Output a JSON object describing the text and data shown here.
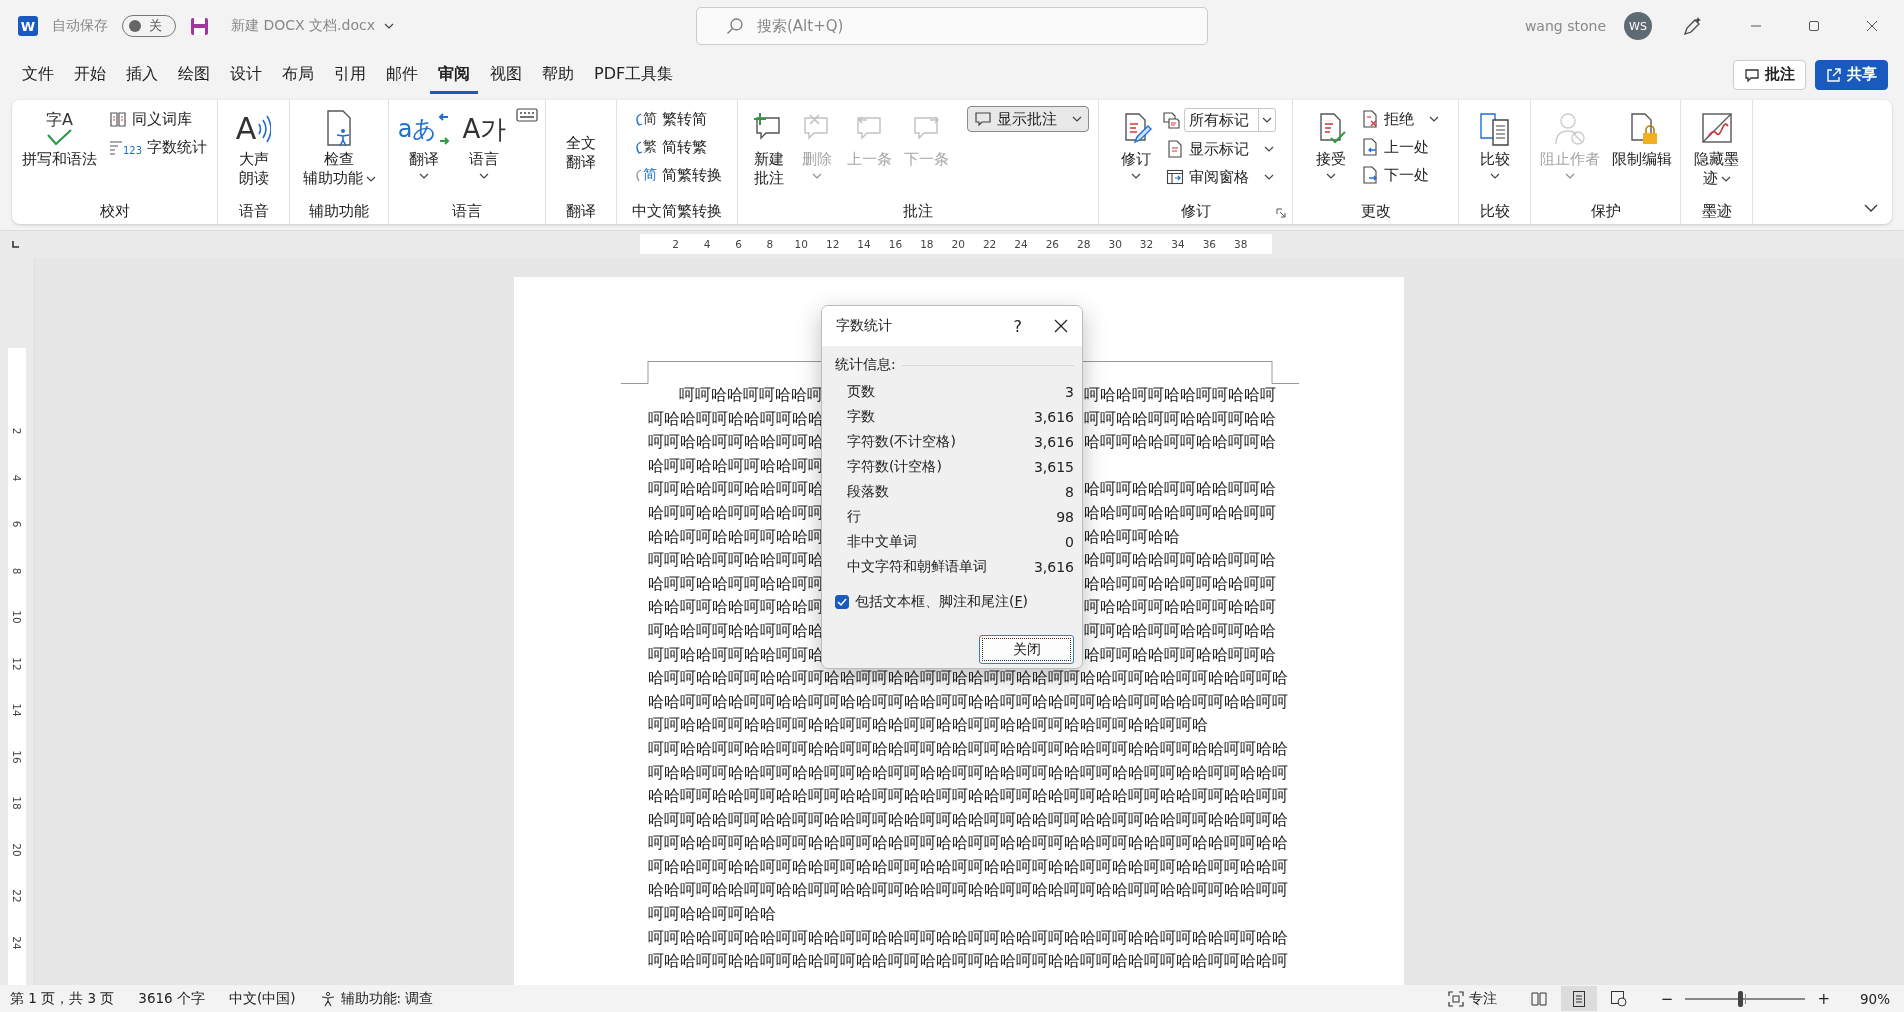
{
  "title_bar": {
    "logo_text": "W",
    "autosave_label": "自动保存",
    "autosave": {
      "on": false,
      "text": "关"
    },
    "file_name": "新建 DOCX 文档.docx",
    "search": {
      "placeholder": "搜索(Alt+Q)"
    },
    "user_name": "wang stone",
    "avatar_initials": "WS"
  },
  "tabs": [
    {
      "label": "文件",
      "selected": false
    },
    {
      "label": "开始",
      "selected": false
    },
    {
      "label": "插入",
      "selected": false
    },
    {
      "label": "绘图",
      "selected": false
    },
    {
      "label": "设计",
      "selected": false
    },
    {
      "label": "布局",
      "selected": false
    },
    {
      "label": "引用",
      "selected": false
    },
    {
      "label": "邮件",
      "selected": false
    },
    {
      "label": "审阅",
      "selected": true
    },
    {
      "label": "视图",
      "selected": false
    },
    {
      "label": "帮助",
      "selected": false
    },
    {
      "label": "PDF工具集",
      "selected": false
    }
  ],
  "tab_buttons": [
    {
      "label": "批注",
      "kind": "plain"
    },
    {
      "label": "共享",
      "kind": "primary"
    }
  ],
  "ribbon": {
    "groups": [
      {
        "label": "校对",
        "launcher": false,
        "columns": [
          [
            {
              "kind": "large",
              "label": [
                "拼写和语法"
              ],
              "icon_text": "字A",
              "menu": false,
              "disabled": false
            }
          ],
          [
            {
              "kind": "small",
              "label": "同义词库",
              "menu": false,
              "disabled": false
            },
            {
              "kind": "small",
              "label": "字数统计",
              "icon_text": "123",
              "menu": false,
              "disabled": false
            }
          ]
        ]
      },
      {
        "label": "语音",
        "launcher": false,
        "columns": [
          [
            {
              "kind": "large",
              "label": [
                "大声",
                "朗读"
              ],
              "icon_text": "A",
              "menu": false,
              "disabled": false
            }
          ]
        ]
      },
      {
        "label": "辅助功能",
        "launcher": false,
        "columns": [
          [
            {
              "kind": "large",
              "label": [
                "检查",
                "辅助功能"
              ],
              "menu": true,
              "disabled": false
            }
          ]
        ]
      },
      {
        "label": "语言",
        "launcher": false,
        "columns": [
          [
            {
              "kind": "large",
              "label": [
                "翻译"
              ],
              "icon_text": "aあ",
              "menu": true,
              "disabled": false
            }
          ],
          [
            {
              "kind": "large",
              "label": [
                "语言"
              ],
              "icon_text": "A가",
              "menu": true,
              "disabled": false
            }
          ],
          [
            {
              "kind": "icon",
              "menu": false,
              "disabled": false
            }
          ]
        ]
      },
      {
        "label": "翻译",
        "launcher": false,
        "columns": [
          [
            {
              "kind": "text",
              "label": [
                "全文",
                "翻译"
              ],
              "menu": false,
              "disabled": false
            }
          ]
        ]
      },
      {
        "label": "中文简繁转换",
        "launcher": false,
        "columns": [
          [
            {
              "kind": "small",
              "label": "繁转简",
              "icon_text": "简",
              "menu": false,
              "disabled": false
            },
            {
              "kind": "small",
              "label": "简转繁",
              "icon_text": "繁",
              "menu": false,
              "disabled": false
            },
            {
              "kind": "small",
              "label": "简繁转换",
              "icon_text": "简",
              "menu": false,
              "disabled": false
            }
          ]
        ]
      },
      {
        "label": "批注",
        "launcher": false,
        "columns": [
          [
            {
              "kind": "large",
              "label": [
                "新建",
                "批注"
              ],
              "menu": false,
              "disabled": false
            }
          ],
          [
            {
              "kind": "large",
              "label": [
                "删除"
              ],
              "menu": true,
              "disabled": true
            }
          ],
          [
            {
              "kind": "large",
              "label": [
                "上一条"
              ],
              "menu": false,
              "disabled": true
            }
          ],
          [
            {
              "kind": "large",
              "label": [
                "下一条"
              ],
              "menu": false,
              "disabled": true
            }
          ],
          [
            {
              "kind": "toggle",
              "label": "显示批注",
              "on": true,
              "menu": true,
              "disabled": false
            }
          ]
        ]
      },
      {
        "label": "修订",
        "launcher": true,
        "columns": [
          [
            {
              "kind": "large",
              "label": [
                "修订"
              ],
              "menu": true,
              "disabled": false
            }
          ],
          [
            {
              "kind": "combo",
              "value": "所有标记",
              "menu": true,
              "disabled": false
            },
            {
              "kind": "small",
              "label": "显示标记",
              "menu": true,
              "disabled": false
            },
            {
              "kind": "small",
              "label": "审阅窗格",
              "menu": true,
              "disabled": false
            }
          ]
        ]
      },
      {
        "label": "更改",
        "launcher": false,
        "columns": [
          [
            {
              "kind": "large",
              "label": [
                "接受"
              ],
              "menu": true,
              "disabled": false
            }
          ],
          [
            {
              "kind": "small",
              "label": "拒绝",
              "menu": true,
              "disabled": false
            },
            {
              "kind": "small",
              "label": "上一处",
              "menu": false,
              "disabled": false
            },
            {
              "kind": "small",
              "label": "下一处",
              "menu": false,
              "disabled": false
            }
          ]
        ]
      },
      {
        "label": "比较",
        "launcher": false,
        "columns": [
          [
            {
              "kind": "large",
              "label": [
                "比较"
              ],
              "menu": true,
              "disabled": false
            }
          ]
        ]
      },
      {
        "label": "保护",
        "launcher": false,
        "columns": [
          [
            {
              "kind": "large",
              "label": [
                "阻止作者"
              ],
              "menu": true,
              "disabled": true
            }
          ],
          [
            {
              "kind": "large",
              "label": [
                "限制编辑"
              ],
              "menu": false,
              "disabled": false
            }
          ]
        ]
      },
      {
        "label": "墨迹",
        "launcher": false,
        "columns": [
          [
            {
              "kind": "large",
              "label": [
                "隐藏墨",
                "迹"
              ],
              "menu": true,
              "disabled": false
            }
          ]
        ]
      }
    ]
  },
  "ruler": {
    "numbers": [
      "2",
      "4",
      "6",
      "8",
      "10",
      "12",
      "14",
      "16",
      "18",
      "20",
      "22",
      "24",
      "26",
      "28",
      "30",
      "32",
      "34",
      "36",
      "38"
    ],
    "vertical_numbers": [
      "2",
      "4",
      "6",
      "8",
      "10",
      "12",
      "14",
      "16",
      "18",
      "20",
      "22",
      "24"
    ]
  },
  "document": {
    "lines": [
      {
        "kind": "split",
        "indent": true,
        "left": "呵呵哈哈呵呵哈哈呵",
        "right": "呵哈哈呵呵哈哈呵呵哈哈呵"
      },
      {
        "kind": "split",
        "indent": false,
        "left": "呵哈哈呵呵哈哈呵呵哈哈",
        "right": "呵呵哈哈呵呵哈哈呵呵哈哈"
      },
      {
        "kind": "split",
        "indent": false,
        "left": "呵呵哈哈呵呵哈哈呵呵哈",
        "right": "哈呵呵哈哈呵呵哈哈呵呵哈"
      },
      {
        "kind": "split",
        "indent": false,
        "left": "哈呵呵哈哈呵呵哈哈呵呵"
      },
      {
        "kind": "split",
        "indent": false,
        "left": "呵呵哈哈呵呵哈哈呵呵哈",
        "right": "哈呵呵哈哈呵呵哈哈呵呵哈"
      },
      {
        "kind": "split",
        "indent": false,
        "left": "哈呵呵哈哈呵呵哈哈呵呵",
        "right": "哈哈呵呵哈哈呵呵哈哈呵呵"
      },
      {
        "kind": "split",
        "indent": false,
        "left": "哈哈呵呵哈哈呵呵哈哈呵",
        "right": "哈哈呵呵哈哈"
      },
      {
        "kind": "split",
        "indent": false,
        "left": "呵呵哈哈呵呵哈哈呵呵哈",
        "right": "哈呵呵哈哈呵呵哈哈呵呵哈"
      },
      {
        "kind": "split",
        "indent": false,
        "left": "哈呵呵哈哈呵呵哈哈呵呵",
        "right": "哈哈呵呵哈哈呵呵哈哈呵呵"
      },
      {
        "kind": "split",
        "indent": false,
        "left": "哈哈呵呵哈哈呵呵哈哈呵",
        "right": "呵哈哈呵呵哈哈呵呵哈哈呵"
      },
      {
        "kind": "split",
        "indent": false,
        "left": "呵哈哈呵呵哈哈呵呵哈哈",
        "right": "呵呵哈哈呵呵哈哈呵呵哈哈"
      },
      {
        "kind": "split",
        "indent": false,
        "left": "呵呵哈哈呵呵哈哈呵呵哈",
        "right": "哈呵呵哈哈呵呵哈哈呵呵哈"
      },
      {
        "kind": "full",
        "indent": false,
        "text": "哈呵呵哈哈呵呵哈哈呵呵哈哈呵呵哈哈呵呵哈哈呵呵哈哈呵呵哈哈呵呵哈哈呵呵哈哈呵呵哈"
      },
      {
        "kind": "full",
        "indent": false,
        "text": "哈哈呵呵哈哈呵呵哈哈呵呵哈哈呵呵哈哈呵呵哈哈呵呵哈哈呵呵哈哈呵呵哈哈呵呵哈哈呵呵"
      },
      {
        "kind": "full",
        "indent": false,
        "text": "呵呵哈哈呵呵哈哈呵呵哈哈呵呵哈哈呵呵哈哈呵呵哈哈呵呵哈哈呵呵哈哈呵呵哈"
      },
      {
        "kind": "full",
        "indent": false,
        "text": "呵呵哈哈呵呵哈哈呵呵哈哈呵呵哈哈呵呵哈哈呵呵哈哈呵呵哈哈呵呵哈哈呵呵哈哈呵呵哈哈"
      },
      {
        "kind": "full",
        "indent": false,
        "text": "呵哈哈呵呵哈哈呵呵哈哈呵呵哈哈呵呵哈哈呵呵哈哈呵呵哈哈呵呵哈哈呵呵哈哈呵呵哈哈呵"
      },
      {
        "kind": "full",
        "indent": false,
        "text": "哈哈呵呵哈哈呵呵哈哈呵呵哈哈呵呵哈哈呵呵哈哈呵呵哈哈呵呵哈哈呵呵哈哈呵呵哈哈呵呵"
      },
      {
        "kind": "full",
        "indent": false,
        "text": "哈呵呵哈哈呵呵哈哈呵呵哈哈呵呵哈哈呵呵哈哈呵呵哈哈呵呵哈哈呵呵哈哈呵呵哈哈呵呵哈"
      },
      {
        "kind": "full",
        "indent": false,
        "text": "呵呵哈哈呵呵哈哈呵呵哈哈呵呵哈哈呵呵哈哈呵呵哈哈呵呵哈哈呵呵哈哈呵呵哈哈呵呵哈哈"
      },
      {
        "kind": "full",
        "indent": false,
        "text": "呵哈哈呵呵哈哈呵呵哈哈呵呵哈哈呵呵哈哈呵呵哈哈呵呵哈哈呵呵哈哈呵呵哈哈呵呵哈哈呵"
      },
      {
        "kind": "full",
        "indent": false,
        "text": "哈哈呵呵哈哈呵呵哈哈呵呵哈哈呵呵哈哈呵呵哈哈呵呵哈哈呵呵哈哈呵呵哈哈呵呵哈哈呵呵"
      },
      {
        "kind": "full",
        "indent": false,
        "text": "呵呵哈哈呵呵哈哈"
      },
      {
        "kind": "full",
        "indent": false,
        "text": "呵呵哈哈呵呵哈哈呵呵哈哈呵呵哈哈呵呵哈哈呵呵哈哈呵呵哈哈呵呵哈哈呵呵哈哈呵呵哈哈"
      },
      {
        "kind": "full",
        "indent": false,
        "text": "呵哈哈呵呵哈哈呵呵哈哈呵呵哈哈呵呵哈哈呵呵哈哈呵呵哈哈呵呵哈哈呵呵哈哈呵呵哈哈呵"
      }
    ]
  },
  "dialog": {
    "title": "字数统计",
    "help": "?",
    "section": "统计信息:",
    "stats": [
      {
        "label": "页数",
        "value": "3"
      },
      {
        "label": "字数",
        "value": "3,616"
      },
      {
        "label": "字符数(不计空格)",
        "value": "3,616"
      },
      {
        "label": "字符数(计空格)",
        "value": "3,615"
      },
      {
        "label": "段落数",
        "value": "8"
      },
      {
        "label": "行",
        "value": "98"
      },
      {
        "label": "非中文单词",
        "value": "0"
      },
      {
        "label": "中文字符和朝鲜语单词",
        "value": "3,616"
      }
    ],
    "option": {
      "checked": true,
      "label_parts": [
        "包括文本框、脚注和尾注(",
        "F",
        ")"
      ]
    },
    "close_button": "关闭"
  },
  "status_bar": {
    "page": "第 1 页，共 3 页",
    "words": "3616 个字",
    "language": "中文(中国)",
    "accessibility": "辅助功能: 调查",
    "focus": "专注",
    "views": [
      {
        "selected": false
      },
      {
        "selected": true
      },
      {
        "selected": false
      }
    ],
    "zoom_out": "−",
    "zoom": {
      "level": 0.455
    },
    "zoom_in": "+",
    "zoom_text": "90%"
  }
}
